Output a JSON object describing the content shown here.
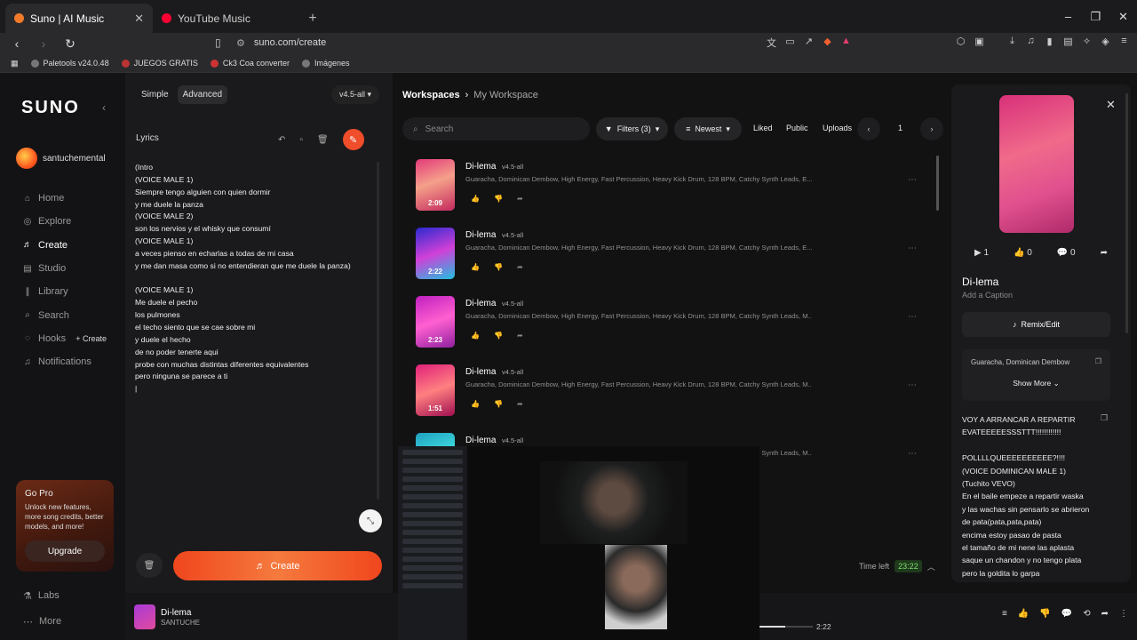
{
  "browser": {
    "tabs": [
      {
        "title": "Suno | AI Music",
        "favicon_color": "#f07a2a"
      },
      {
        "title": "YouTube Music",
        "favicon_color": "#ff0033"
      }
    ],
    "url": "suno.com/create",
    "bookmarks": [
      "Paletools v24.0.48",
      "JUEGOS GRATIS",
      "Ck3 Coa converter",
      "Imágenes"
    ]
  },
  "sidebar": {
    "logo": "SUNO",
    "username": "santuchemental",
    "nav": [
      {
        "label": "Home",
        "icon": "home-icon"
      },
      {
        "label": "Explore",
        "icon": "compass-icon"
      },
      {
        "label": "Create",
        "icon": "create-icon",
        "active": true
      },
      {
        "label": "Studio",
        "icon": "studio-icon"
      },
      {
        "label": "Library",
        "icon": "library-icon"
      },
      {
        "label": "Search",
        "icon": "search-icon"
      },
      {
        "label": "Hooks",
        "icon": "hooks-icon"
      },
      {
        "label": "Notifications",
        "icon": "bell-icon"
      }
    ],
    "hooks_create": "+ Create",
    "gopro": {
      "title": "Go Pro",
      "text": "Unlock new features, more song credits, better models, and more!",
      "button": "Upgrade"
    },
    "labs": "Labs",
    "more": "More"
  },
  "create_panel": {
    "mode_simple": "Simple",
    "mode_advanced": "Advanced",
    "version": "v4.5-all",
    "lyrics_label": "Lyrics",
    "lyrics": "(Intro\n(VOICE MALE 1)\nSiempre tengo alguien con quien dormir\ny me duele la panza\n(VOICE MALE 2)\nson los nervios y el whisky que consumí\n(VOICE MALE 1)\na veces pienso en echarlas a todas de mi casa\ny me dan masa como si no entendieran que me duele la panza)\n\n(VOICE MALE 1)\nMe duele el pecho\nlos pulmones\nel techo siento que se cae sobre mi\ny duele el hecho\nde no poder tenerte aqui\nprobe con muchas distintas diferentes equivalentes\npero ninguna se parece a ti\n|",
    "create_button": "Create"
  },
  "workspace": {
    "breadcrumb_root": "Workspaces",
    "breadcrumb_current": "My Workspace",
    "search_placeholder": "Search",
    "filters": "Filters (3)",
    "sort": "Newest",
    "liked": "Liked",
    "public": "Public",
    "uploads": "Uploads",
    "page": "1",
    "songs": [
      {
        "title": "Di-lema",
        "version": "v4.5-all",
        "tags": "Guaracha, Dominican Dembow, High Energy, Fast Percussion, Heavy Kick Drum, 128 BPM, Catchy Synth Leads, E...",
        "duration": "2:09"
      },
      {
        "title": "Di-lema",
        "version": "v4.5-all",
        "tags": "Guaracha, Dominican Dembow, High Energy, Fast Percussion, Heavy Kick Drum, 128 BPM, Catchy Synth Leads, E...",
        "duration": "2:22"
      },
      {
        "title": "Di-lema",
        "version": "v4.5-all",
        "tags": "Guaracha, Dominican Dembow, High Energy, Fast Percussion, Heavy Kick Drum, 128 BPM, Catchy Synth Leads, M...",
        "duration": "2:23"
      },
      {
        "title": "Di-lema",
        "version": "v4.5-all",
        "tags": "Guaracha, Dominican Dembow, High Energy, Fast Percussion, Heavy Kick Drum, 128 BPM, Catchy Synth Leads, M...",
        "duration": "1:51"
      },
      {
        "title": "Di-lema",
        "version": "v4.5-all",
        "tags": "Guaracha, Dominican Dembow, High Energy, Fast Percussion, Heavy Kick Drum, 128 BPM, Catchy Synth Leads, M...",
        "duration": ""
      }
    ],
    "time_left_label": "Time left",
    "time_left_value": "23:22"
  },
  "right_panel": {
    "plays": "1",
    "likes": "0",
    "comments": "0",
    "title": "Di-lema",
    "caption": "Add a Caption",
    "remix": "Remix/Edit",
    "styles": "Guaracha, Dominican Dembow",
    "show_more": "Show More",
    "lyrics": "VOY A ARRANCAR A REPARTIR\nEVATEEEEESSSTTT!!!!!!!!!!!!\n\nPOLLLLQUEEEEEEEEEE?!!!!\n(VOICE DOMINICAN MALE 1)\n(Tuchito VEVO)\nEn el baile empeze a repartir waska\ny las wachas sin pensarlo se abrieron\nde pata(pata,pata,pata)\nencima estoy pasao de pasta\nel tamaño de mi nene las aplasta\nsaque un chandon y no tengo plata\npero la goldita lo garpa"
  },
  "player": {
    "title": "Di-lema",
    "artist": "SANTUCHE",
    "time": "2:22",
    "progress": 0.48
  }
}
